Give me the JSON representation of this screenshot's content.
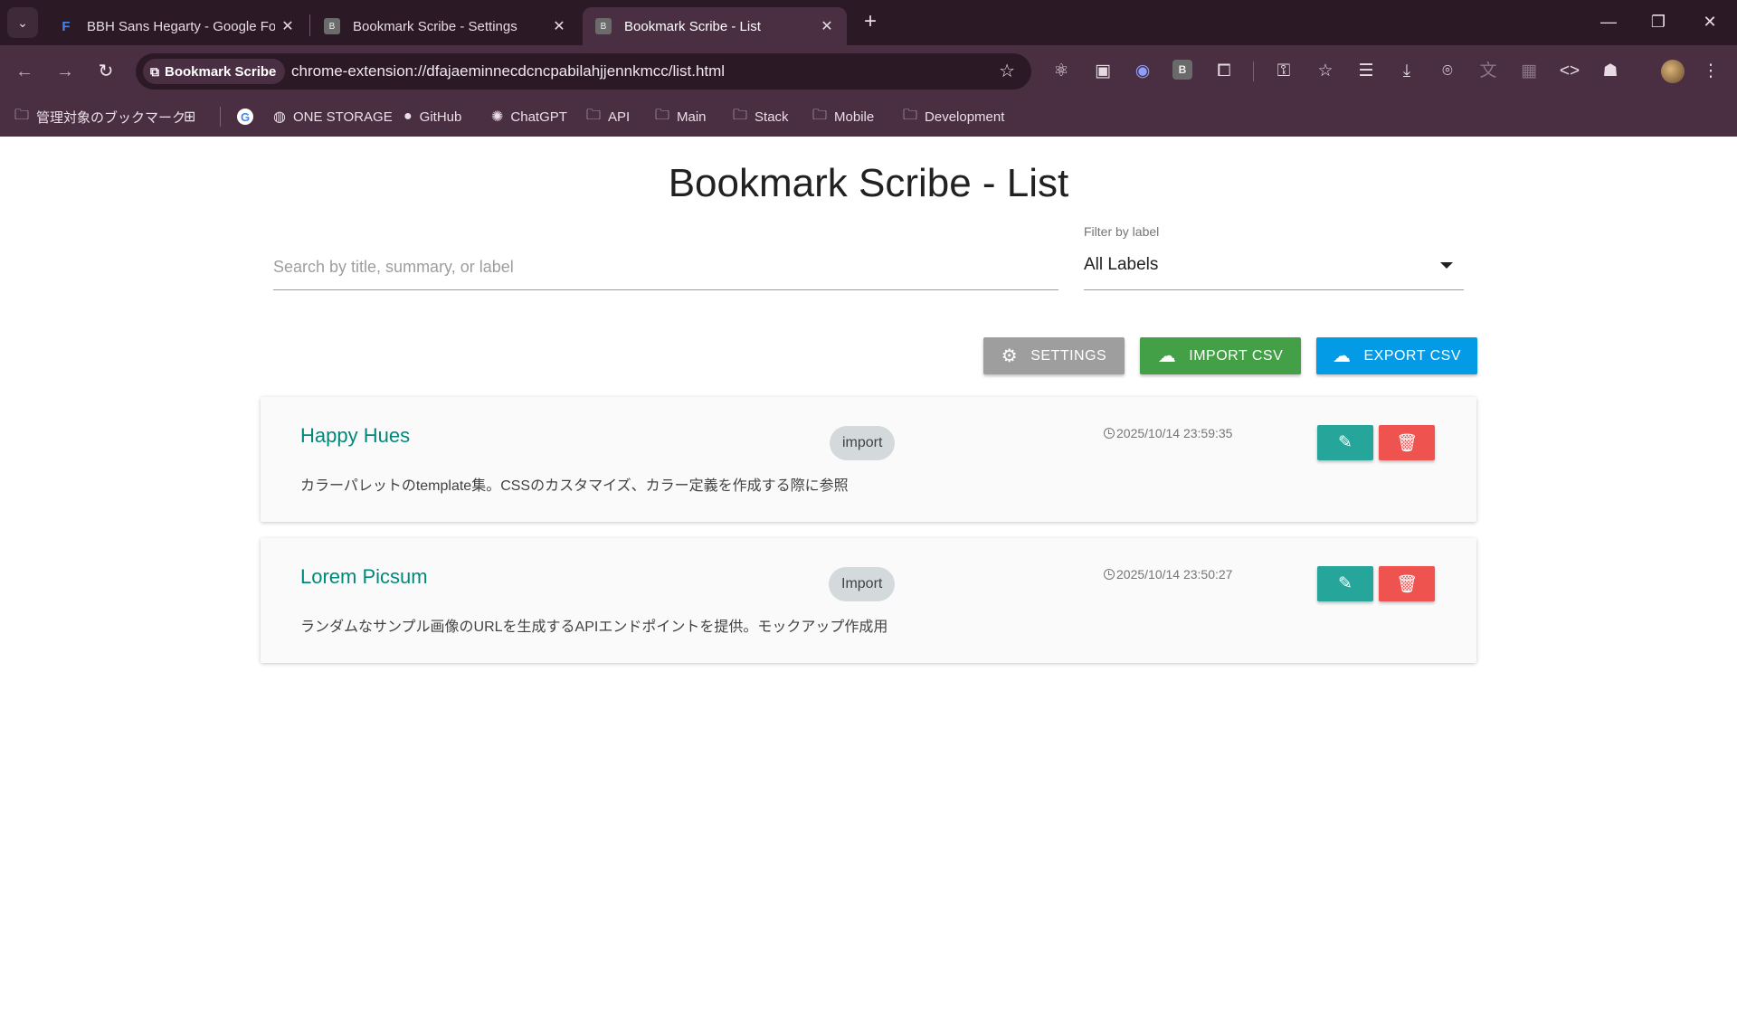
{
  "browser": {
    "tabs": [
      {
        "title": "BBH Sans Hegarty - Google Fon",
        "favicon": "google-fonts-icon",
        "active": false
      },
      {
        "title": "Bookmark Scribe - Settings",
        "favicon": "B",
        "active": false
      },
      {
        "title": "Bookmark Scribe - List",
        "favicon": "B",
        "active": true
      }
    ],
    "site_chip": "Bookmark Scribe",
    "url": "chrome-extension://dfajaeminnecdcncpabilahjjennkmcc/list.html",
    "extension_letter": "B",
    "bookmarks": [
      {
        "label": "管理対象のブックマーク",
        "icon": "managed-folder-icon"
      },
      {
        "label": "",
        "icon": "apps-grid-icon"
      },
      {
        "label": "",
        "icon": "google-icon"
      },
      {
        "label": "ONE STORAGE",
        "icon": "globe-icon"
      },
      {
        "label": "GitHub",
        "icon": "github-icon"
      },
      {
        "label": "ChatGPT",
        "icon": "chatgpt-icon"
      },
      {
        "label": "API",
        "icon": "folder-icon"
      },
      {
        "label": "Main",
        "icon": "folder-icon"
      },
      {
        "label": "Stack",
        "icon": "folder-icon"
      },
      {
        "label": "Mobile",
        "icon": "folder-icon"
      },
      {
        "label": "Development",
        "icon": "folder-icon"
      }
    ]
  },
  "page": {
    "title": "Bookmark Scribe - List",
    "search": {
      "placeholder": "Search by title, summary, or label",
      "value": ""
    },
    "filter": {
      "label": "Filter by label",
      "value": "All Labels"
    },
    "buttons": {
      "settings": "SETTINGS",
      "import": "IMPORT CSV",
      "export": "EXPORT CSV"
    },
    "bookmarks": [
      {
        "title": "Happy Hues",
        "label": "import",
        "timestamp": "2025/10/14 23:59:35",
        "summary": "カラーパレットのtemplate集。CSSのカスタマイズ、カラー定義を作成する際に参照"
      },
      {
        "title": "Lorem Picsum",
        "label": "Import",
        "timestamp": "2025/10/14 23:50:27",
        "summary": "ランダムなサンプル画像のURLを生成するAPIエンドポイントを提供。モックアップ作成用"
      }
    ]
  },
  "colors": {
    "accent_teal": "#00897b",
    "edit_button": "#26a69a",
    "delete_button": "#ef5350",
    "settings_button": "#9e9e9e",
    "import_button": "#43a047",
    "export_button": "#039be5",
    "browser_frame": "#4a2f43"
  }
}
